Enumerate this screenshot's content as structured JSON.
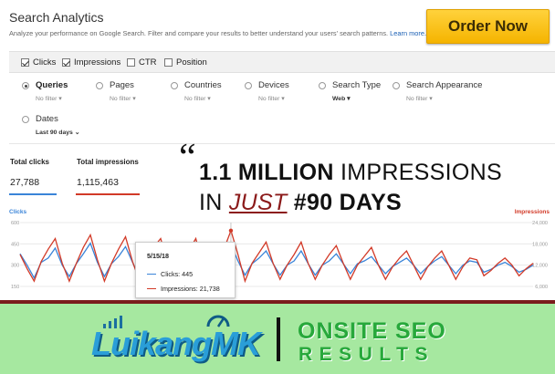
{
  "header": {
    "title": "Search Analytics",
    "subtitle": "Analyze your performance on Google Search. Filter and compare your results to better understand your users' search patterns.",
    "learn_more": "Learn more.",
    "order_button": "Order Now"
  },
  "metrics": [
    {
      "label": "Clicks",
      "checked": true
    },
    {
      "label": "Impressions",
      "checked": true
    },
    {
      "label": "CTR",
      "checked": false
    },
    {
      "label": "Position",
      "checked": false
    }
  ],
  "groups": [
    {
      "label": "Queries",
      "sub": "No filter",
      "selected": true
    },
    {
      "label": "Pages",
      "sub": "No filter",
      "selected": false
    },
    {
      "label": "Countries",
      "sub": "No filter",
      "selected": false
    },
    {
      "label": "Devices",
      "sub": "No filter",
      "selected": false
    },
    {
      "label": "Search Type",
      "sub": "Web",
      "selected": false
    },
    {
      "label": "Search Appearance",
      "sub": "No filter",
      "selected": false
    },
    {
      "label": "Dates",
      "sub": "Last 90 days",
      "selected": false
    }
  ],
  "totals": {
    "clicks_label": "Total clicks",
    "clicks_value": "27,788",
    "impressions_label": "Total impressions",
    "impressions_value": "1,115,463"
  },
  "headline": {
    "quote_mark": "“",
    "line1_bold": "1.1 MILLION",
    "line1_rest": " IMPRESSIONS",
    "line2_pre": "IN ",
    "line2_just": "JUST",
    "line2_bold": " #90 DAYS"
  },
  "chart": {
    "left_legend": "Clicks",
    "right_legend": "Impressions",
    "left_ticks": [
      "600",
      "450",
      "300",
      "150"
    ],
    "right_ticks": [
      "24,000",
      "18,000",
      "12,000",
      "6,000"
    ],
    "tooltip": {
      "date": "5/15/18",
      "clicks": "Clicks: 445",
      "impressions": "Impressions: 21,738"
    }
  },
  "chart_data": {
    "type": "line",
    "title": "",
    "xlabel": "",
    "ylabel": "Clicks",
    "ylim": [
      150,
      600
    ],
    "y2label": "Impressions",
    "y2lim": [
      6000,
      24000
    ],
    "series": [
      {
        "name": "Clicks",
        "color": "#3a84d8",
        "axis": "left",
        "values": [
          380,
          300,
          210,
          320,
          350,
          420,
          300,
          220,
          310,
          380,
          455,
          320,
          220,
          310,
          360,
          430,
          320,
          210,
          320,
          360,
          420,
          300,
          210,
          300,
          340,
          410,
          300,
          210,
          310,
          360,
          445,
          330,
          230,
          310,
          350,
          400,
          310,
          230,
          300,
          330,
          400,
          310,
          230,
          300,
          330,
          380,
          310,
          240,
          310,
          330,
          360,
          300,
          240,
          290,
          320,
          350,
          300,
          240,
          290,
          330,
          360,
          300,
          240,
          300,
          330,
          320,
          250,
          270,
          300,
          320,
          290,
          250,
          270,
          300
        ]
      },
      {
        "name": "Impressions",
        "color": "#d23a28",
        "axis": "right",
        "values": [
          15000,
          11000,
          7500,
          13000,
          16500,
          19500,
          12500,
          7500,
          12500,
          17000,
          20500,
          13500,
          7500,
          12500,
          16500,
          20000,
          13000,
          7500,
          12500,
          17000,
          19500,
          12500,
          7500,
          12000,
          16000,
          19500,
          12000,
          7500,
          12500,
          16500,
          21738,
          15000,
          7500,
          12500,
          15500,
          18500,
          12500,
          8000,
          12000,
          15000,
          18500,
          12500,
          8000,
          12000,
          15000,
          17500,
          12500,
          8000,
          12000,
          14500,
          17000,
          12000,
          8000,
          11500,
          14000,
          16000,
          12000,
          8000,
          11500,
          14000,
          16000,
          12000,
          8000,
          11500,
          14000,
          13500,
          9000,
          10500,
          12500,
          14000,
          12000,
          9000,
          11000,
          12500
        ]
      }
    ],
    "highlight": {
      "label": "5/15/18",
      "clicks": 445,
      "impressions": 21738
    }
  },
  "banner": {
    "logo_text": "LuikangMK",
    "right_line1": "ONSITE SEO",
    "right_line2": "RESULTS"
  },
  "colors": {
    "clicks": "#3a84d8",
    "impressions": "#d23a28",
    "order_button": "#f5b400",
    "banner_bg": "#a6e8a0",
    "banner_text": "#27a83b",
    "accent_dark_red": "#7a1c1c"
  }
}
